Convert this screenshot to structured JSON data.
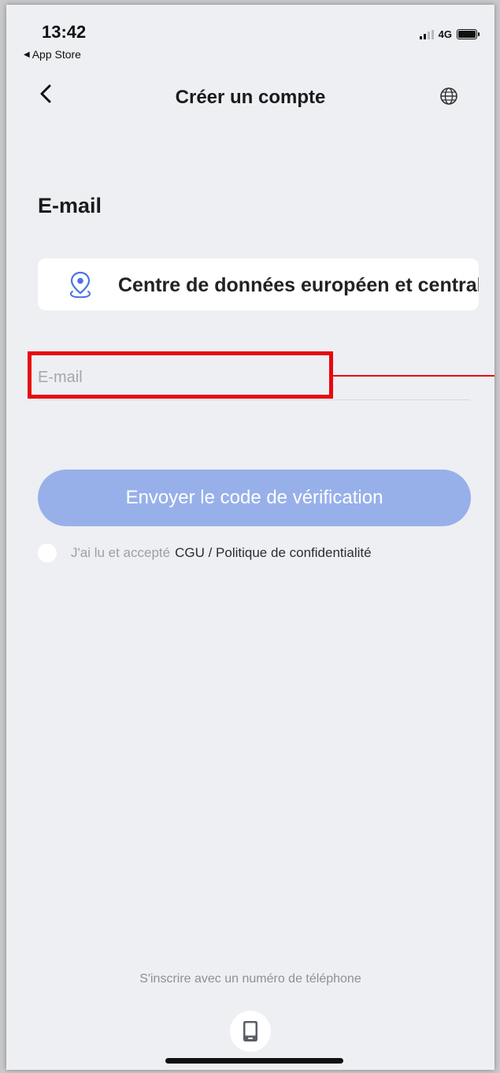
{
  "status_bar": {
    "time": "13:42",
    "back_to_app": "App Store",
    "network": "4G",
    "icons": [
      "signal-icon",
      "battery-icon"
    ]
  },
  "nav": {
    "title": "Créer un compte",
    "back_icon": "chevron-left-icon",
    "language_icon": "globe-icon"
  },
  "form": {
    "heading": "E-mail",
    "region": {
      "icon": "location-pin-icon",
      "label": "Centre de données européen et central"
    },
    "email_placeholder": "E-mail",
    "email_value": "",
    "send_button_label": "Envoyer le code de vérification",
    "terms": {
      "prefix": "J'ai lu et accepté",
      "links": "CGU / Politique de confidentialité",
      "checked": false
    }
  },
  "footer": {
    "alt_signup_label": "S'inscrire avec un numéro de téléphone",
    "alt_signup_icon": "mobile-phone-icon"
  },
  "colors": {
    "background": "#eeeff3",
    "button": "#98b0ea",
    "accent": "#4a73e0",
    "highlight": "#e8080d"
  }
}
